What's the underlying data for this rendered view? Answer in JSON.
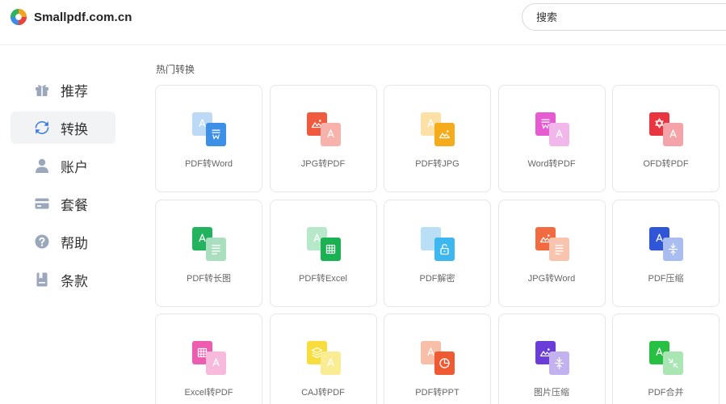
{
  "brand": {
    "name": "Smallpdf.com.cn"
  },
  "search": {
    "placeholder": "搜索"
  },
  "sidebar": {
    "items": [
      {
        "label": "推荐",
        "icon": "gift-icon",
        "active": false
      },
      {
        "label": "转换",
        "icon": "sync-icon",
        "active": true
      },
      {
        "label": "账户",
        "icon": "user-icon",
        "active": false
      },
      {
        "label": "套餐",
        "icon": "card-icon",
        "active": false
      },
      {
        "label": "帮助",
        "icon": "help-icon",
        "active": false
      },
      {
        "label": "条款",
        "icon": "bookmark-icon",
        "active": false
      }
    ]
  },
  "main": {
    "section_title": "热门转换",
    "tools": [
      {
        "label": "PDF转Word",
        "icon": "pdf-to-word-icon",
        "back": "#bcd9f6",
        "front": "#3e8fe6",
        "back_glyph": "pdf",
        "front_glyph": "word"
      },
      {
        "label": "JPG转PDF",
        "icon": "jpg-to-pdf-icon",
        "back": "#f05a3f",
        "front": "#f7b3ab",
        "back_glyph": "image",
        "front_glyph": "pdf"
      },
      {
        "label": "PDF转JPG",
        "icon": "pdf-to-jpg-icon",
        "back": "#fde0a6",
        "front": "#f6ab1c",
        "back_glyph": "pdf",
        "front_glyph": "image"
      },
      {
        "label": "Word转PDF",
        "icon": "word-to-pdf-icon",
        "back": "#e65bd2",
        "front": "#f2b7ea",
        "back_glyph": "word",
        "front_glyph": "pdf"
      },
      {
        "label": "OFD转PDF",
        "icon": "ofd-to-pdf-icon",
        "back": "#e8353f",
        "front": "#f4a3a8",
        "back_glyph": "ofd",
        "front_glyph": "pdf"
      },
      {
        "label": "PDF转长图",
        "icon": "pdf-to-long-image-icon",
        "back": "#23b25d",
        "front": "#a9dfbe",
        "back_glyph": "pdf",
        "front_glyph": "doc"
      },
      {
        "label": "PDF转Excel",
        "icon": "pdf-to-excel-icon",
        "back": "#b6e8c9",
        "front": "#19b152",
        "back_glyph": "pdf",
        "front_glyph": "table"
      },
      {
        "label": "PDF解密",
        "icon": "pdf-decrypt-icon",
        "back": "#b8dff6",
        "front": "#3cb7ef",
        "back_glyph": "none",
        "front_glyph": "unlock"
      },
      {
        "label": "JPG转Word",
        "icon": "jpg-to-word-icon",
        "back": "#f26a40",
        "front": "#f8c4ad",
        "back_glyph": "image",
        "front_glyph": "doc"
      },
      {
        "label": "PDF压缩",
        "icon": "pdf-compress-icon",
        "back": "#2e56d6",
        "front": "#a9bdf0",
        "back_glyph": "pdf",
        "front_glyph": "compress"
      },
      {
        "label": "Excel转PDF",
        "icon": "excel-to-pdf-icon",
        "back": "#ee5cb0",
        "front": "#f7b9dc",
        "back_glyph": "table",
        "front_glyph": "pdf"
      },
      {
        "label": "CAJ转PDF",
        "icon": "caj-to-pdf-icon",
        "back": "#f7de3e",
        "front": "#f9ec93",
        "back_glyph": "layers",
        "front_glyph": "pdf"
      },
      {
        "label": "PDF转PPT",
        "icon": "pdf-to-ppt-icon",
        "back": "#f7bfa8",
        "front": "#f05a33",
        "back_glyph": "pdf",
        "front_glyph": "ppt"
      },
      {
        "label": "图片压缩",
        "icon": "image-compress-icon",
        "back": "#6a3cd8",
        "front": "#c3b2ef",
        "back_glyph": "image",
        "front_glyph": "compress"
      },
      {
        "label": "PDF合并",
        "icon": "pdf-merge-icon",
        "back": "#27c043",
        "front": "#a9e6b4",
        "back_glyph": "pdf",
        "front_glyph": "merge"
      }
    ]
  }
}
